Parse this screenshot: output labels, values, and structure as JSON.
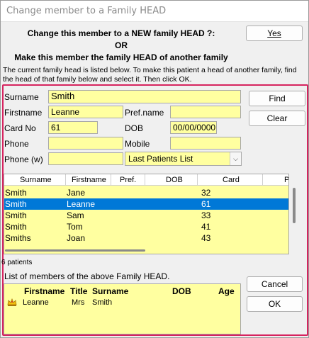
{
  "window": {
    "title": "Change member to a Family HEAD"
  },
  "headings": {
    "line1": "Change this member to a NEW family HEAD ?:",
    "or": "OR",
    "line2": "Make this member the family HEAD of another family"
  },
  "info_text": "The current family head is listed below. To make this patient a head of another family, find the head of that family below and select it. Then click OK.",
  "buttons": {
    "yes": "Yes",
    "find": "Find",
    "clear": "Clear",
    "cancel": "Cancel",
    "ok": "OK"
  },
  "form": {
    "surname_label": "Surname",
    "surname_value": "Smith",
    "firstname_label": "Firstname",
    "firstname_value": "Leanne",
    "prefname_label": "Pref.name",
    "prefname_value": "",
    "cardno_label": "Card No",
    "cardno_value": "61",
    "dob_label": "DOB",
    "dob_value": "00/00/0000",
    "phone_label": "Phone",
    "phone_value": "",
    "mobile_label": "Mobile",
    "mobile_value": "",
    "phonew_label": "Phone (w)",
    "phonew_value": "",
    "list_select": "Last Patients List"
  },
  "grid": {
    "columns": [
      "Surname",
      "Firstname",
      "Pref.",
      "DOB",
      "Card",
      "P"
    ],
    "rows": [
      {
        "surname": "Smith",
        "firstname": "Jane",
        "pref": "",
        "dob": "",
        "card": "32",
        "selected": false
      },
      {
        "surname": "Smith",
        "firstname": "Leanne",
        "pref": "",
        "dob": "",
        "card": "61",
        "selected": true
      },
      {
        "surname": "Smith",
        "firstname": "Sam",
        "pref": "",
        "dob": "",
        "card": "33",
        "selected": false
      },
      {
        "surname": "Smith",
        "firstname": "Tom",
        "pref": "",
        "dob": "",
        "card": "41",
        "selected": false
      },
      {
        "surname": "Smiths",
        "firstname": "Joan",
        "pref": "",
        "dob": "",
        "card": "43",
        "selected": false
      }
    ],
    "count_text": "6 patients"
  },
  "members": {
    "title": "List of members of the above Family HEAD.",
    "columns": [
      "Firstname",
      "Title",
      "Surname",
      "DOB",
      "Age"
    ],
    "rows": [
      {
        "icon": "crown-icon",
        "firstname": "Leanne",
        "title": "Mrs",
        "surname": "Smith",
        "dob": "",
        "age": ""
      }
    ]
  },
  "colors": {
    "field_bg": "#ffffa0",
    "selection": "#0078d7",
    "frame": "#d6245f"
  }
}
